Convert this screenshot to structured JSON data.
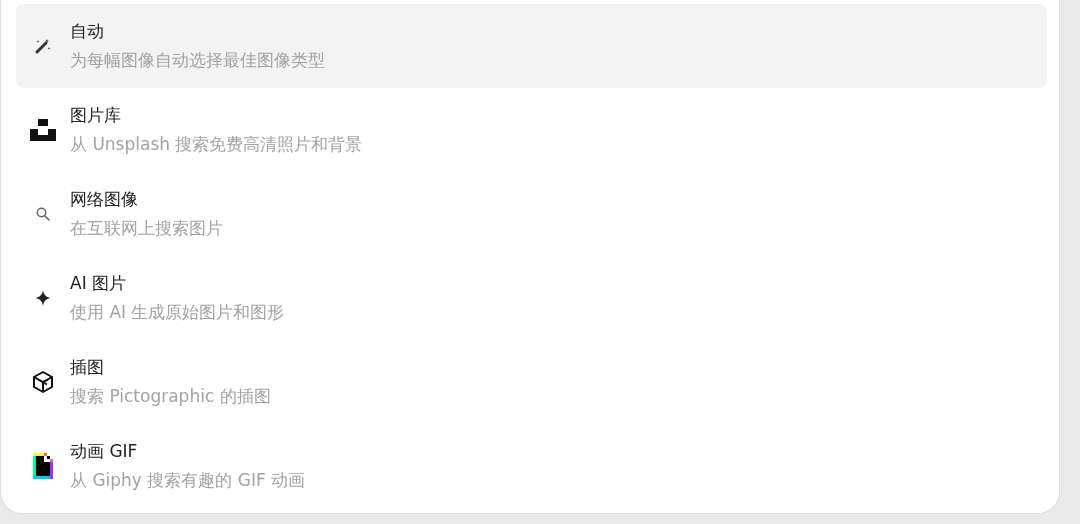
{
  "menu": {
    "items": [
      {
        "kind": "auto",
        "title": "自动",
        "description": "为每幅图像自动选择最佳图像类型",
        "selected": true
      },
      {
        "kind": "unsplash",
        "title": "图片库",
        "description": "从 Unsplash 搜索免费高清照片和背景",
        "selected": false
      },
      {
        "kind": "web",
        "title": "网络图像",
        "description": "在互联网上搜索图片",
        "selected": false
      },
      {
        "kind": "ai",
        "title": "AI 图片",
        "description": "使用 AI 生成原始图片和图形",
        "selected": false
      },
      {
        "kind": "illustration",
        "title": "插图",
        "description": "搜索 Pictographic 的插图",
        "selected": false
      },
      {
        "kind": "gif",
        "title": "动画 GIF",
        "description": "从 Giphy 搜索有趣的 GIF 动画",
        "selected": false
      }
    ]
  }
}
